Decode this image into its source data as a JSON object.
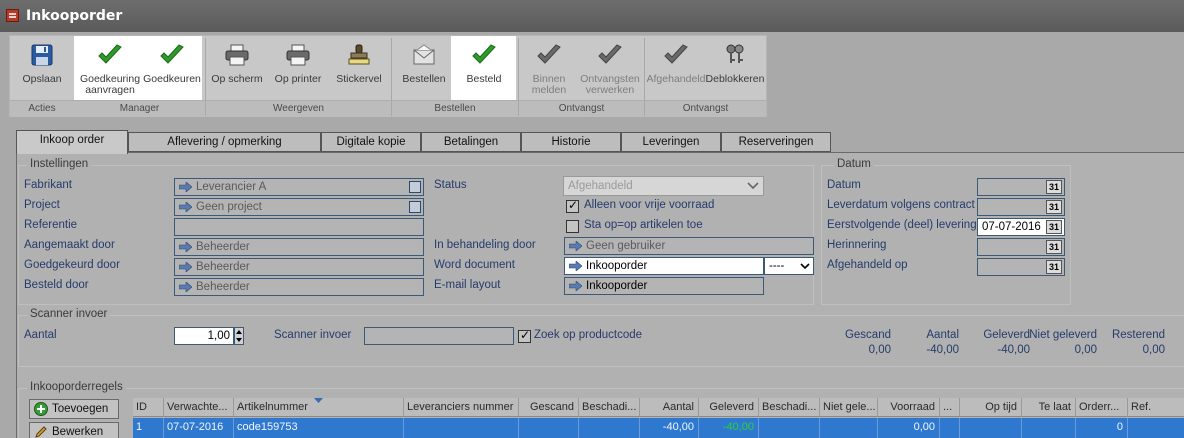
{
  "window": {
    "title": "Inkooporder"
  },
  "ribbon": {
    "buttons": [
      {
        "label": "Opslaan",
        "icon": "save-icon"
      },
      {
        "label": "Goedkeuring aanvragen",
        "icon": "green-check-icon"
      },
      {
        "label": "Goedkeuren",
        "icon": "green-check-icon"
      },
      {
        "label": "Op scherm",
        "icon": "printer-icon"
      },
      {
        "label": "Op printer",
        "icon": "printer-icon"
      },
      {
        "label": "Stickervel",
        "icon": "stamp-icon"
      },
      {
        "label": "Bestellen",
        "icon": "envelope-icon"
      },
      {
        "label": "Besteld",
        "icon": "green-check-icon"
      },
      {
        "label": "Binnen melden",
        "icon": "gray-check-icon"
      },
      {
        "label": "Ontvangsten verwerken",
        "icon": "gray-check-icon"
      },
      {
        "label": "Afgehandeld",
        "icon": "gray-check-icon"
      },
      {
        "label": "Deblokkeren",
        "icon": "keys-icon"
      }
    ],
    "groups": [
      "Acties",
      "Manager",
      "Weergeven",
      "Bestellen",
      "Ontvangst",
      "Ontvangst"
    ]
  },
  "tabs": [
    "Inkoop order",
    "Aflevering / opmerking",
    "Digitale kopie",
    "Betalingen",
    "Historie",
    "Leveringen",
    "Reserveringen"
  ],
  "instellingen": {
    "legend": "Instellingen",
    "fabrikant": {
      "label": "Fabrikant",
      "value": "Leverancier A"
    },
    "project": {
      "label": "Project",
      "value": "Geen project"
    },
    "referentie": {
      "label": "Referentie",
      "value": ""
    },
    "aangemaakt": {
      "label": "Aangemaakt door",
      "value": "Beheerder"
    },
    "goedgekeurd": {
      "label": "Goedgekeurd door",
      "value": "Beheerder"
    },
    "besteld": {
      "label": "Besteld door",
      "value": "Beheerder"
    },
    "status": {
      "label": "Status",
      "value": "Afgehandeld"
    },
    "vrije_voorraad": {
      "label": "Alleen voor vrije voorraad",
      "checked": true
    },
    "sta_op": {
      "label": "Sta op=op artikelen toe",
      "checked": false
    },
    "in_behandeling": {
      "label": "In behandeling door",
      "value": "Geen gebruiker"
    },
    "word_document": {
      "label": "Word document",
      "value": "Inkooporder",
      "extra": "----"
    },
    "email_layout": {
      "label": "E-mail layout",
      "value": "Inkooporder"
    }
  },
  "datum": {
    "legend": "Datum",
    "fields": [
      {
        "label": "Datum",
        "value": ""
      },
      {
        "label": "Leverdatum volgens contract",
        "value": ""
      },
      {
        "label": "Eerstvolgende (deel) levering",
        "value": "07-07-2016"
      },
      {
        "label": "Herinnering",
        "value": ""
      },
      {
        "label": "Afgehandeld op",
        "value": ""
      }
    ],
    "calendar_label": "31"
  },
  "scanner": {
    "legend": "Scanner invoer",
    "aantal_label": "Aantal",
    "aantal_value": "1,00",
    "scanner_label": "Scanner invoer",
    "scanner_value": "",
    "zoek_label": "Zoek op productcode",
    "zoek_checked": true,
    "stats": [
      {
        "label": "Gescand",
        "value": "0,00"
      },
      {
        "label": "Aantal",
        "value": "-40,00"
      },
      {
        "label": "Geleverd",
        "value": "-40,00"
      },
      {
        "label": "Niet geleverd",
        "value": "0,00"
      },
      {
        "label": "Resterend",
        "value": "0,00"
      }
    ]
  },
  "regels": {
    "legend": "Inkooporderregels",
    "add_button": "Toevoegen",
    "edit_button": "Bewerken",
    "columns": [
      "ID",
      "Verwachte...",
      "Artikelnummer",
      "Leveranciers nummer",
      "Gescand",
      "Beschadi...",
      "Aantal",
      "Geleverd",
      "Beschadi...",
      "Niet gele...",
      "Voorraad",
      "...",
      "Op tijd",
      "Te laat",
      "Orderr...",
      "Ref."
    ],
    "row": [
      "1",
      "07-07-2016",
      "code159753",
      "",
      "",
      "",
      "-40,00",
      "-40,00",
      "",
      "",
      "0,00",
      "",
      "",
      "",
      "0",
      ""
    ]
  }
}
